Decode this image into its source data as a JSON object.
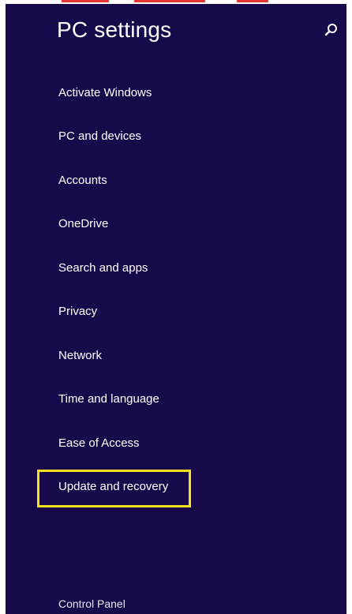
{
  "header": {
    "title": "PC settings",
    "search_icon": "search-icon"
  },
  "nav": {
    "items": [
      {
        "label": "Activate Windows"
      },
      {
        "label": "PC and devices"
      },
      {
        "label": "Accounts"
      },
      {
        "label": "OneDrive"
      },
      {
        "label": "Search and apps"
      },
      {
        "label": "Privacy"
      },
      {
        "label": "Network"
      },
      {
        "label": "Time and language"
      },
      {
        "label": "Ease of Access"
      },
      {
        "label": "Update and recovery",
        "highlighted": true
      }
    ]
  },
  "footer": {
    "control_panel": "Control Panel"
  },
  "colors": {
    "background": "#17094a",
    "text": "#ffffff",
    "highlight_border": "#f5e11a",
    "top_mark": "#e53935"
  }
}
